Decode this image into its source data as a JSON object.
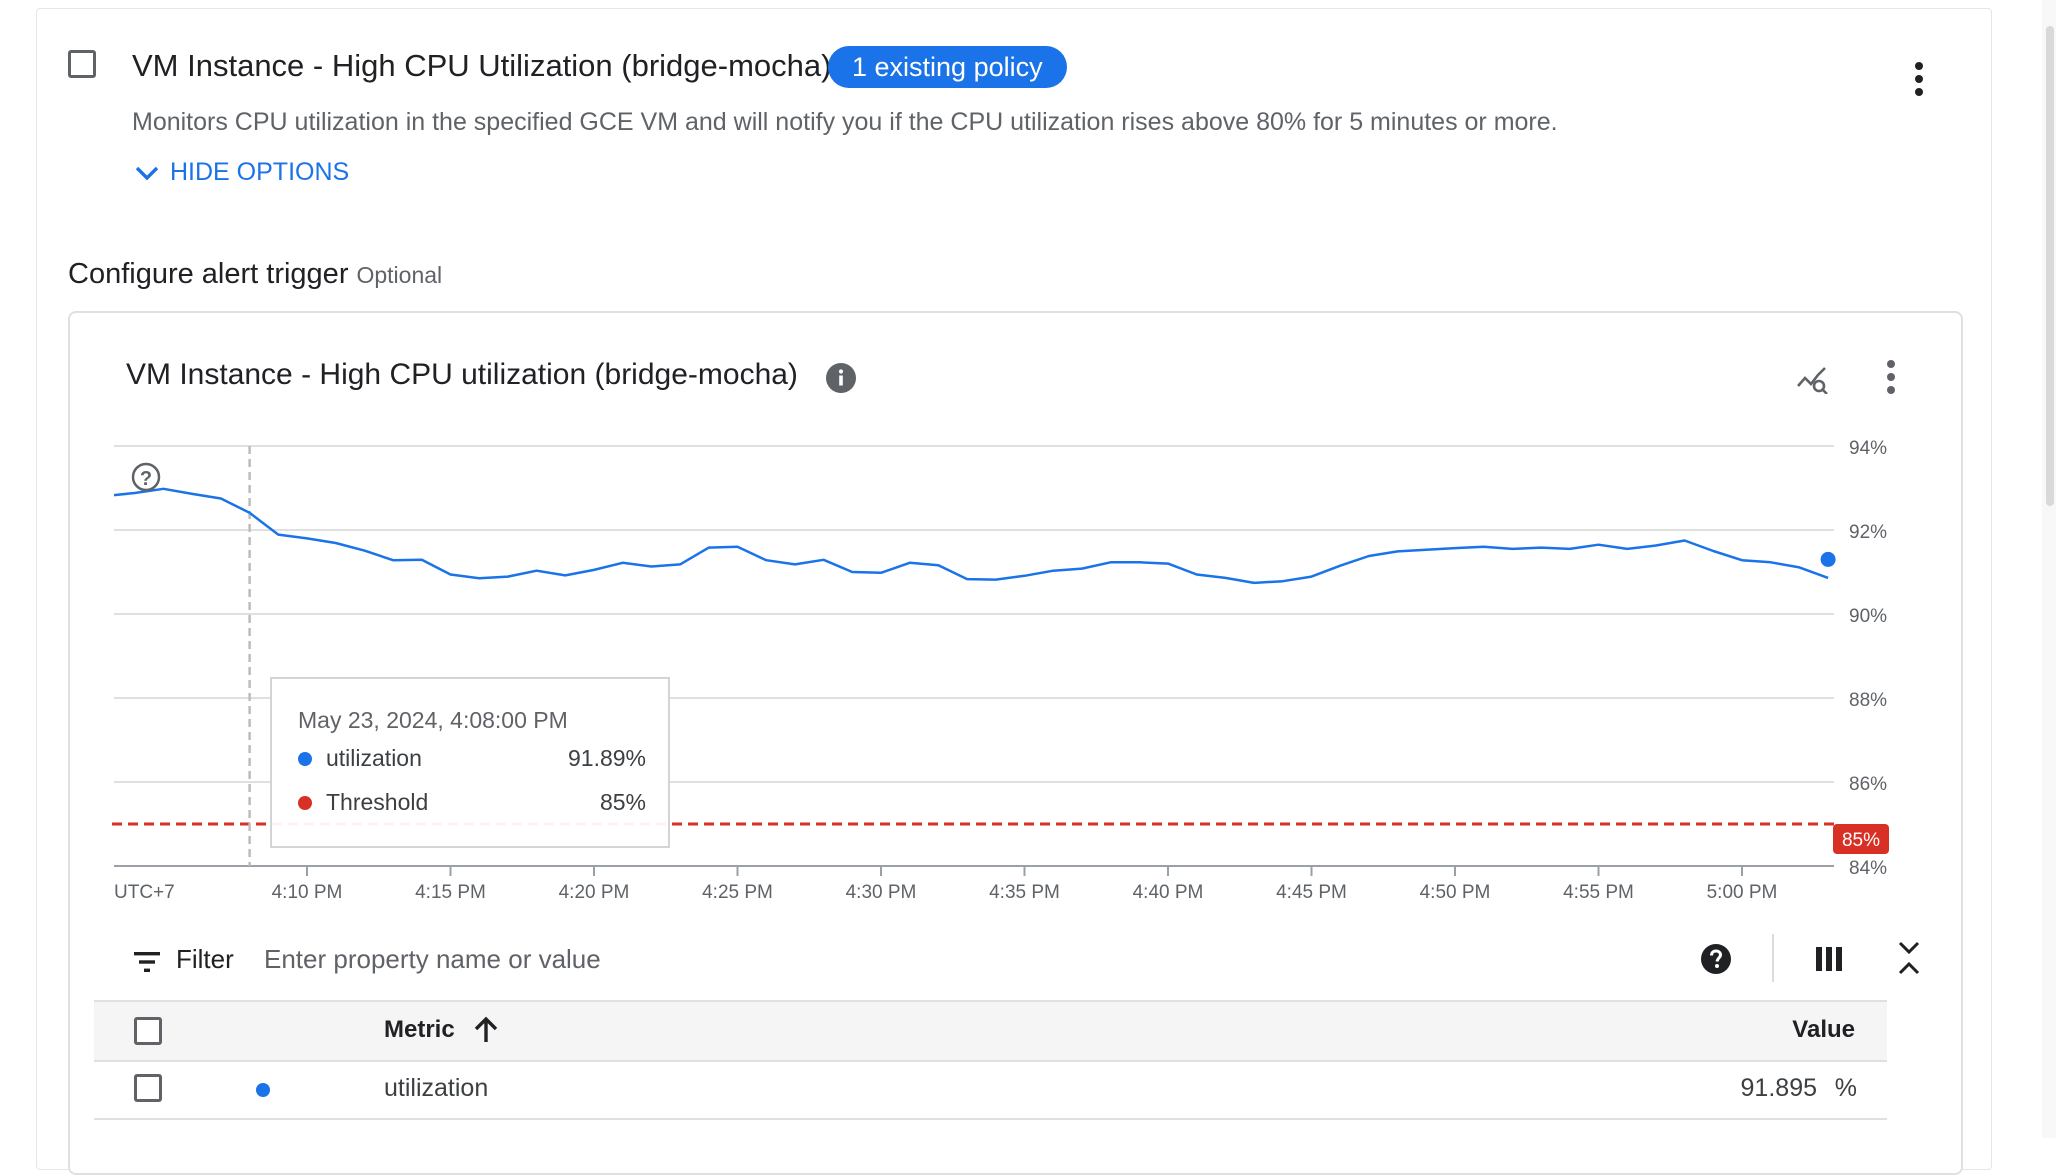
{
  "policy": {
    "title": "VM Instance - High CPU Utilization (bridge-mocha)",
    "chip": "1 existing policy",
    "description": "Monitors CPU utilization in the specified GCE VM and will notify you if the CPU utilization rises above 80% for 5 minutes or more.",
    "hide_options": "HIDE OPTIONS"
  },
  "section": {
    "title": "Configure alert trigger",
    "optional": "Optional"
  },
  "chart_card": {
    "title": "VM Instance - High CPU utilization (bridge-mocha)"
  },
  "tooltip": {
    "date": "May 23, 2024, 4:08:00 PM",
    "rows": [
      {
        "name": "utilization",
        "value": "91.89%",
        "color": "#1a73e8"
      },
      {
        "name": "Threshold",
        "value": "85%",
        "color": "#d93025"
      }
    ]
  },
  "filter": {
    "label": "Filter",
    "placeholder": "Enter property name or value"
  },
  "table": {
    "headers": {
      "metric": "Metric",
      "value": "Value"
    },
    "rows": [
      {
        "metric": "utilization",
        "value": "91.895",
        "unit": "%"
      }
    ]
  },
  "colors": {
    "accent": "#1a73e8",
    "threshold": "#d93025",
    "grid": "#e0e0e0"
  },
  "icons": {
    "info": "info-icon",
    "explore": "explore-chart-icon",
    "more": "more-vert-icon",
    "help": "help-icon",
    "columns": "columns-icon",
    "collapse": "unfold-less-icon",
    "sort": "arrow-upward-icon",
    "filter": "filter-list-icon",
    "chevron": "chevron-down-icon",
    "question": "question-circle-icon"
  },
  "chart_data": {
    "type": "line",
    "timezone_label": "UTC+7",
    "x_tick_labels": [
      "4:10 PM",
      "4:15 PM",
      "4:20 PM",
      "4:25 PM",
      "4:30 PM",
      "4:35 PM",
      "4:40 PM",
      "4:45 PM",
      "4:50 PM",
      "4:55 PM",
      "5:00 PM"
    ],
    "y_tick_labels": [
      "94%",
      "92%",
      "90%",
      "88%",
      "86%",
      "84%"
    ],
    "y_ticks": [
      94,
      92,
      90,
      88,
      86,
      84
    ],
    "ylim": [
      84,
      94
    ],
    "x_minutes_start": "3:56 PM",
    "threshold": {
      "name": "Threshold",
      "value": 85,
      "label": "85%"
    },
    "hover_time": "4:08 PM",
    "series": [
      {
        "name": "utilization",
        "color": "#1a73e8",
        "x": [
          "4:04 PM",
          "4:05 PM",
          "4:06 PM",
          "4:07 PM",
          "4:08 PM",
          "4:09 PM",
          "4:10 PM",
          "4:11 PM",
          "4:12 PM",
          "4:13 PM",
          "4:14 PM",
          "4:15 PM",
          "4:16 PM",
          "4:17 PM",
          "4:18 PM",
          "4:19 PM",
          "4:20 PM",
          "4:21 PM",
          "4:22 PM",
          "4:23 PM",
          "4:24 PM",
          "4:25 PM",
          "4:26 PM",
          "4:27 PM",
          "4:28 PM",
          "4:29 PM",
          "4:30 PM",
          "4:31 PM",
          "4:32 PM",
          "4:33 PM",
          "4:34 PM",
          "4:35 PM",
          "4:36 PM",
          "4:37 PM",
          "4:38 PM",
          "4:39 PM",
          "4:40 PM",
          "4:41 PM",
          "4:42 PM",
          "4:43 PM",
          "4:44 PM",
          "4:45 PM",
          "4:46 PM",
          "4:47 PM",
          "4:48 PM",
          "4:49 PM",
          "4:50 PM",
          "4:51 PM",
          "4:52 PM",
          "4:53 PM",
          "4:54 PM",
          "4:55 PM",
          "4:56 PM",
          "4:57 PM",
          "4:58 PM",
          "4:59 PM",
          "5:00 PM",
          "5:01 PM",
          "5:02 PM",
          "5:03 PM"
        ],
        "values": [
          92.88,
          92.98,
          92.86,
          92.75,
          92.41,
          91.89,
          91.8,
          91.69,
          91.51,
          91.28,
          91.29,
          90.94,
          90.85,
          90.89,
          91.03,
          90.92,
          91.05,
          91.22,
          91.13,
          91.18,
          91.58,
          91.6,
          91.28,
          91.18,
          91.29,
          91.0,
          90.98,
          91.22,
          91.16,
          90.83,
          90.82,
          90.91,
          91.03,
          91.08,
          91.23,
          91.23,
          91.2,
          90.94,
          90.86,
          90.74,
          90.78,
          90.89,
          91.15,
          91.38,
          91.49,
          91.53,
          91.57,
          91.6,
          91.55,
          91.58,
          91.55,
          91.65,
          91.55,
          91.63,
          91.75,
          91.5,
          91.28,
          91.23,
          91.11,
          90.86
        ]
      }
    ],
    "last_point": {
      "x": "5:03 PM",
      "value": 91.3
    }
  }
}
